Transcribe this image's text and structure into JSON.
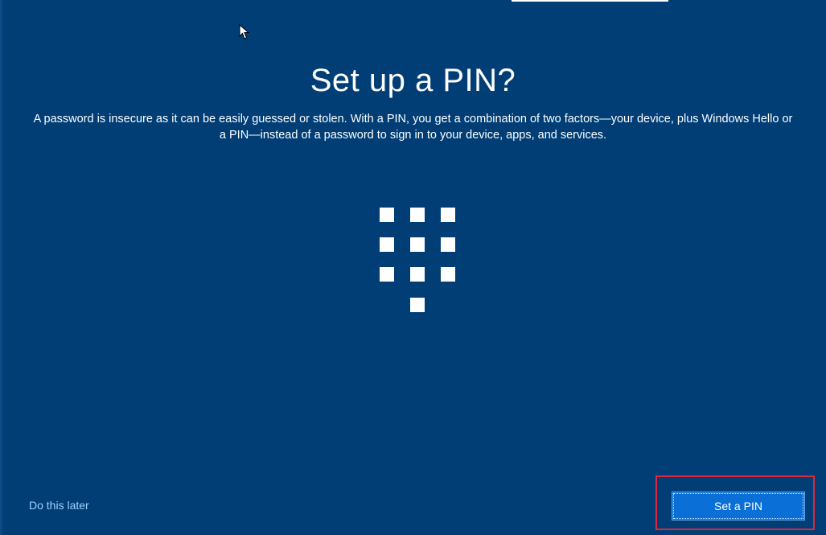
{
  "dialog": {
    "title": "Set up a PIN?",
    "description": "A password is insecure as it can be easily guessed or stolen. With a PIN, you get a combination of two factors—your device, plus Windows Hello or a PIN—instead of a password to sign in to your device, apps, and services.",
    "illustration_icon": "pin-keypad-icon"
  },
  "actions": {
    "later_label": "Do this later",
    "primary_label": "Set a PIN"
  },
  "colors": {
    "background": "#003e75",
    "primary_button": "#0a6fd6",
    "link": "#9fd1ff",
    "highlight": "#e0283b"
  }
}
